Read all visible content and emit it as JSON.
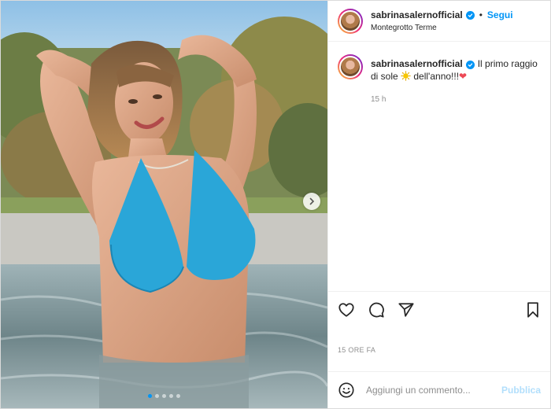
{
  "post": {
    "author": {
      "username": "sabrinasalernofficial",
      "verified": true,
      "follow_label": "Segui",
      "separator": "•",
      "location": "Montegrotto Terme"
    },
    "caption": {
      "username": "sabrinasalernofficial",
      "text_before": "Il primo raggio di sole",
      "emoji_sun": "sun-emoji",
      "text_after": "dell'anno!!!",
      "emoji_heart": "red-heart-emoji"
    },
    "caption_time": "15 h",
    "timeago": "15 ORE FA",
    "carousel": {
      "slide_count": 5,
      "active_index": 0
    },
    "comment": {
      "placeholder": "Aggiungi un commento...",
      "publish_label": "Pubblica"
    }
  },
  "colors": {
    "accent": "#0095f6",
    "publish_disabled": "#b2dffc",
    "heart": "#ed4956",
    "bikini": "#2aa6d8"
  }
}
